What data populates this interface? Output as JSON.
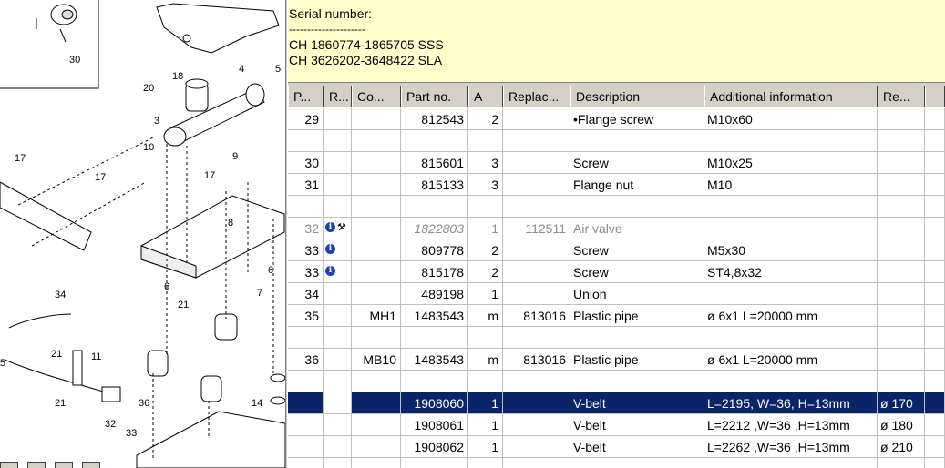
{
  "serial": {
    "title": "Serial number:",
    "dashes": "---------------------",
    "lines": [
      "CH 1860774-1865705 SSS",
      "CH 3626202-3648422 SLA"
    ]
  },
  "diagram": {
    "callouts": [
      "30",
      "18",
      "4",
      "5",
      "20",
      "3",
      "10",
      "9",
      "17",
      "17",
      "17",
      "8",
      "6",
      "6",
      "21",
      "7",
      "34",
      "21",
      "11",
      "21",
      "36",
      "32",
      "33",
      "14",
      "5"
    ]
  },
  "table": {
    "columns": [
      "P...",
      "R...",
      "Co...",
      "Part no.",
      "A",
      "Replac...",
      "Description",
      "Additional information",
      "Re..."
    ],
    "rows": [
      {
        "pos": "29",
        "code": "",
        "part": "812543",
        "qty": "2",
        "repl": "",
        "desc": "•Flange screw",
        "info": "M10x60",
        "rem": "",
        "icons": [],
        "style": "normal"
      },
      {
        "pos": "",
        "code": "",
        "part": "",
        "qty": "",
        "repl": "",
        "desc": "",
        "info": "",
        "rem": "",
        "icons": [],
        "style": "normal"
      },
      {
        "pos": "30",
        "code": "",
        "part": "815601",
        "qty": "3",
        "repl": "",
        "desc": "Screw",
        "info": "M10x25",
        "rem": "",
        "icons": [],
        "style": "normal"
      },
      {
        "pos": "31",
        "code": "",
        "part": "815133",
        "qty": "3",
        "repl": "",
        "desc": "Flange nut",
        "info": "M10",
        "rem": "",
        "icons": [],
        "style": "normal"
      },
      {
        "pos": "",
        "code": "",
        "part": "",
        "qty": "",
        "repl": "",
        "desc": "",
        "info": "",
        "rem": "",
        "icons": [],
        "style": "normal"
      },
      {
        "pos": "32",
        "code": "",
        "part": "1822803",
        "qty": "1",
        "repl": "112511",
        "desc": "Air valve",
        "info": "",
        "rem": "",
        "icons": [
          "info",
          "tool"
        ],
        "style": "grey"
      },
      {
        "pos": "33",
        "code": "",
        "part": "809778",
        "qty": "2",
        "repl": "",
        "desc": "Screw",
        "info": "M5x30",
        "rem": "",
        "icons": [
          "info"
        ],
        "style": "normal"
      },
      {
        "pos": "33",
        "code": "",
        "part": "815178",
        "qty": "2",
        "repl": "",
        "desc": "Screw",
        "info": "ST4,8x32",
        "rem": "",
        "icons": [
          "info"
        ],
        "style": "normal"
      },
      {
        "pos": "34",
        "code": "",
        "part": "489198",
        "qty": "1",
        "repl": "",
        "desc": "Union",
        "info": "",
        "rem": "",
        "icons": [],
        "style": "normal"
      },
      {
        "pos": "35",
        "code": "MH1",
        "part": "1483543",
        "qty": "m",
        "repl": "813016",
        "desc": "Plastic pipe",
        "info": "ø 6x1 L=20000 mm",
        "rem": "",
        "icons": [],
        "style": "normal"
      },
      {
        "pos": "",
        "code": "",
        "part": "",
        "qty": "",
        "repl": "",
        "desc": "",
        "info": "",
        "rem": "",
        "icons": [],
        "style": "normal"
      },
      {
        "pos": "36",
        "code": "MB10",
        "part": "1483543",
        "qty": "m",
        "repl": "813016",
        "desc": "Plastic pipe",
        "info": "ø 6x1 L=20000 mm",
        "rem": "",
        "icons": [],
        "style": "normal"
      },
      {
        "pos": "",
        "code": "",
        "part": "",
        "qty": "",
        "repl": "",
        "desc": "",
        "info": "",
        "rem": "",
        "icons": [],
        "style": "normal"
      },
      {
        "pos": "",
        "code": "",
        "part": "1908060",
        "qty": "1",
        "repl": "",
        "desc": "V-belt",
        "info": "L=2195, W=36, H=13mm",
        "rem": "ø 170",
        "icons": [],
        "style": "selected"
      },
      {
        "pos": "",
        "code": "",
        "part": "1908061",
        "qty": "1",
        "repl": "",
        "desc": "V-belt",
        "info": "L=2212 ,W=36 ,H=13mm",
        "rem": "ø 180",
        "icons": [],
        "style": "normal"
      },
      {
        "pos": "",
        "code": "",
        "part": "1908062",
        "qty": "1",
        "repl": "",
        "desc": "V-belt",
        "info": "L=2262 ,W=36 ,H=13mm",
        "rem": "ø 210",
        "icons": [],
        "style": "normal"
      },
      {
        "pos": "",
        "code": "",
        "part": "",
        "qty": "",
        "repl": "",
        "desc": "",
        "info": "",
        "rem": "",
        "icons": [],
        "style": "normal"
      }
    ]
  }
}
